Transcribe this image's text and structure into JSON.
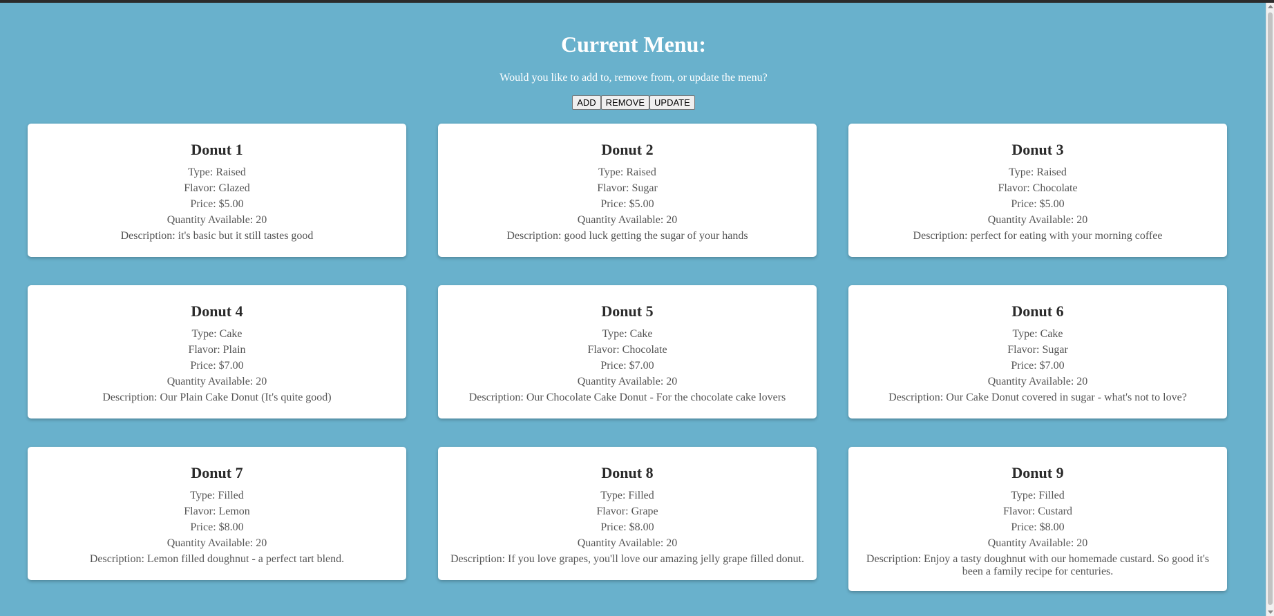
{
  "menu": {
    "title": "Current Menu:",
    "prompt": "Would you like to add to, remove from, or update the menu?",
    "buttons": {
      "add": "ADD",
      "remove": "REMOVE",
      "update": "UPDATE"
    }
  },
  "labels": {
    "type": "Type:",
    "flavor": "Flavor:",
    "price": "Price:",
    "quantity": "Quantity Available:",
    "description": "Description:"
  },
  "donuts": [
    {
      "name": "Donut 1",
      "type": "Raised",
      "flavor": "Glazed",
      "price": "$5.00",
      "quantity": "20",
      "description": "it's basic but it still tastes good"
    },
    {
      "name": "Donut 2",
      "type": "Raised",
      "flavor": "Sugar",
      "price": "$5.00",
      "quantity": "20",
      "description": "good luck getting the sugar of your hands"
    },
    {
      "name": "Donut 3",
      "type": "Raised",
      "flavor": "Chocolate",
      "price": "$5.00",
      "quantity": "20",
      "description": "perfect for eating with your morning coffee"
    },
    {
      "name": "Donut 4",
      "type": "Cake",
      "flavor": "Plain",
      "price": "$7.00",
      "quantity": "20",
      "description": "Our Plain Cake Donut (It's quite good)"
    },
    {
      "name": "Donut 5",
      "type": "Cake",
      "flavor": "Chocolate",
      "price": "$7.00",
      "quantity": "20",
      "description": "Our Chocolate Cake Donut - For the chocolate cake lovers"
    },
    {
      "name": "Donut 6",
      "type": "Cake",
      "flavor": "Sugar",
      "price": "$7.00",
      "quantity": "20",
      "description": "Our Cake Donut covered in sugar - what's not to love?"
    },
    {
      "name": "Donut 7",
      "type": "Filled",
      "flavor": "Lemon",
      "price": "$8.00",
      "quantity": "20",
      "description": "Lemon filled doughnut - a perfect tart blend."
    },
    {
      "name": "Donut 8",
      "type": "Filled",
      "flavor": "Grape",
      "price": "$8.00",
      "quantity": "20",
      "description": "If you love grapes, you'll love our amazing jelly grape filled donut."
    },
    {
      "name": "Donut 9",
      "type": "Filled",
      "flavor": "Custard",
      "price": "$8.00",
      "quantity": "20",
      "description": "Enjoy a tasty doughnut with our homemade custard. So good it's been a family recipe for centuries."
    }
  ],
  "colors": {
    "background": "#69b1cc",
    "card": "#ffffff",
    "heading_text": "#2a2a2a",
    "body_text": "#555555"
  }
}
